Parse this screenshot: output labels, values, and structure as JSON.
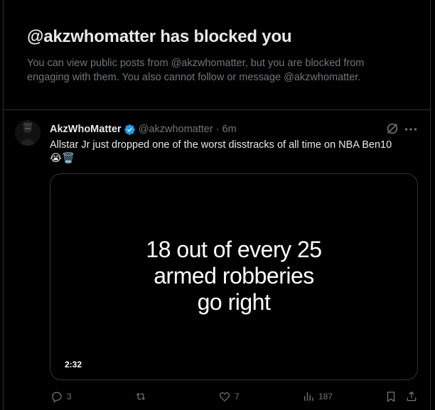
{
  "blocked": {
    "title": "@akzwhomatter has blocked you",
    "description": "You can view public posts from @akzwhomatter, but you are blocked from engaging with them. You also cannot follow or message @akzwhomatter."
  },
  "tweet": {
    "author_name": "AkzWhoMatter",
    "handle": "@akzwhomatter",
    "separator": "·",
    "time": "6m",
    "text": "Allstar Jr just dropped one of the worst disstracks of all time on NBA Ben10",
    "emojis": "😭🗑️",
    "media": {
      "caption_lines": [
        "18 out of every 25",
        "armed robberies",
        "go right"
      ],
      "duration": "2:32"
    },
    "actions": {
      "replies": "3",
      "reposts": "",
      "likes": "7",
      "views": "187"
    }
  },
  "icons": {
    "verified": "verified-badge-icon",
    "grok": "grok-icon",
    "more": "more-icon",
    "reply": "reply-icon",
    "repost": "repost-icon",
    "like": "heart-icon",
    "views": "views-icon",
    "bookmark": "bookmark-icon",
    "share": "share-icon"
  },
  "colors": {
    "background": "#000000",
    "text_primary": "#e7e9ea",
    "text_secondary": "#71767b",
    "border": "#2f3336",
    "verified": "#1d9bf0"
  }
}
